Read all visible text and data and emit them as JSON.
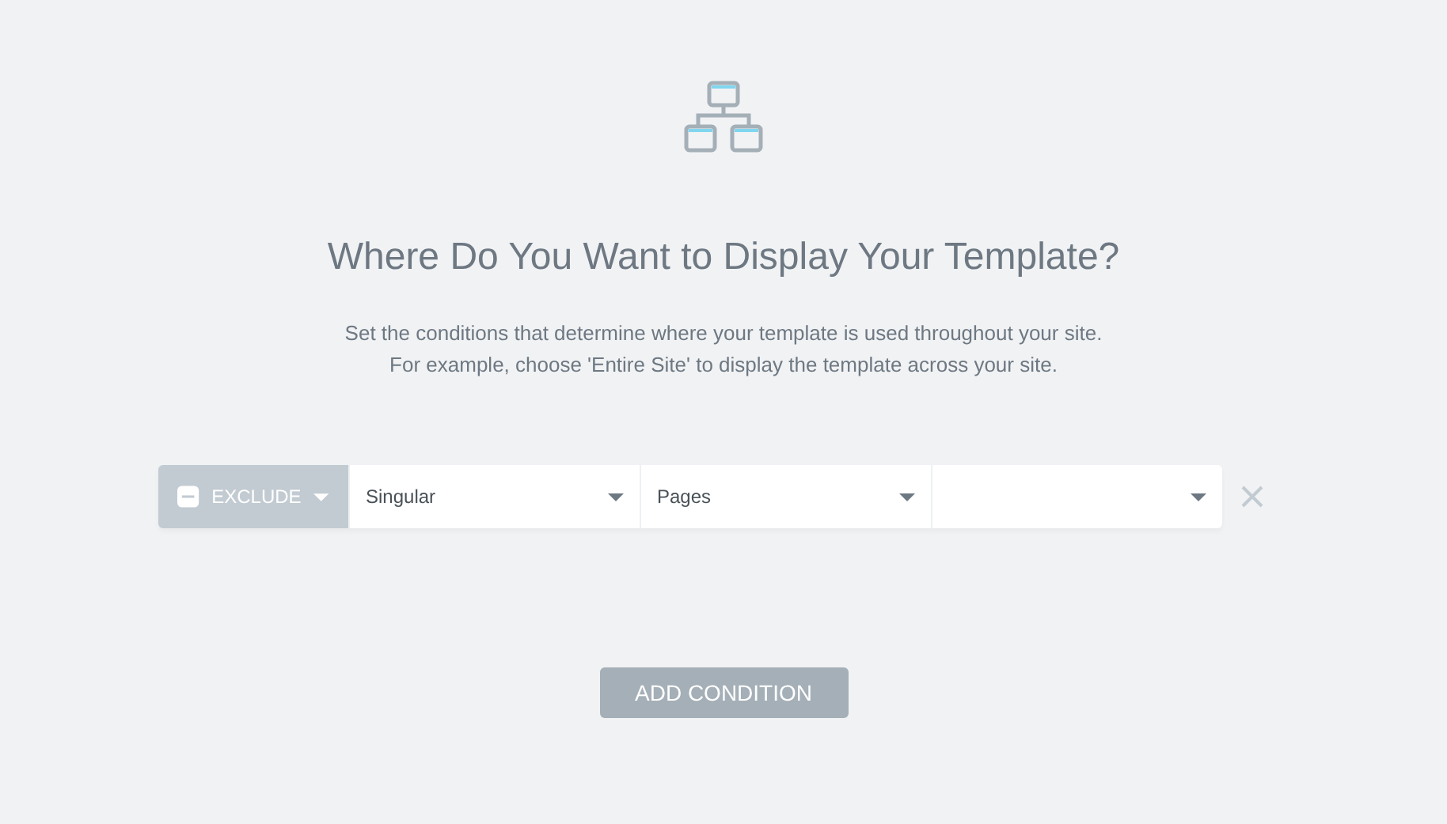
{
  "heading": "Where Do You Want to Display Your Template?",
  "description": [
    "Set the conditions that determine where your template is used throughout your site.",
    "For example, choose 'Entire Site' to display the template across your site."
  ],
  "conditions": [
    {
      "mode": "EXCLUDE",
      "selects": [
        {
          "kind": "filled",
          "value": "Singular"
        },
        {
          "kind": "filled",
          "value": "Pages"
        },
        {
          "kind": "blank"
        }
      ]
    }
  ],
  "add_button": "ADD CONDITION"
}
